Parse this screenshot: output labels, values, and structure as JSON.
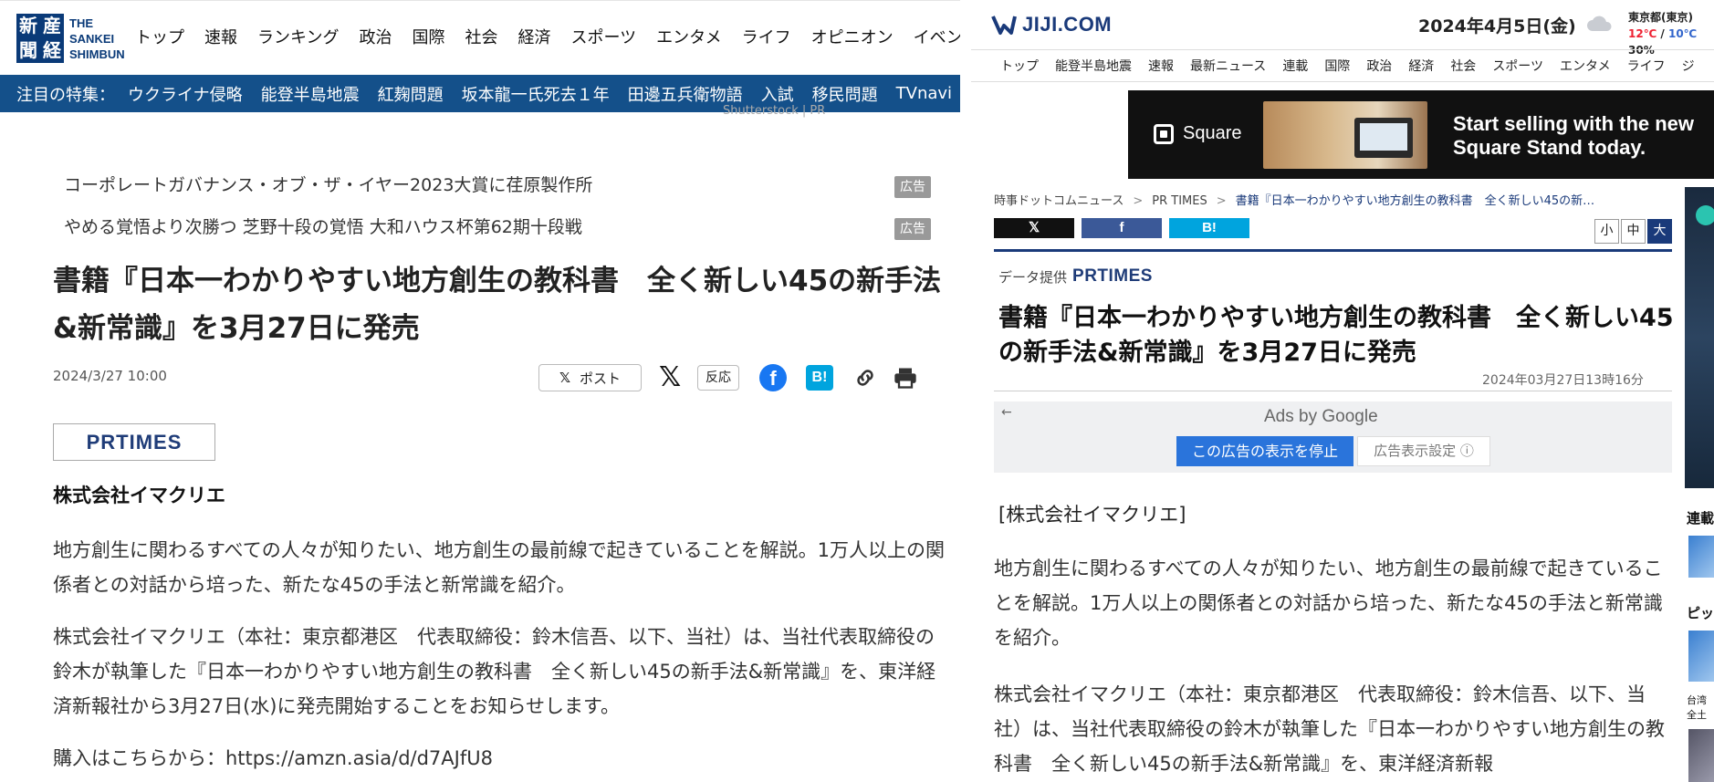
{
  "left": {
    "logo": {
      "kanji": [
        "新",
        "産",
        "聞",
        "経"
      ],
      "text_lines": [
        "THE",
        "SANKEI",
        "SHIMBUN"
      ]
    },
    "nav": [
      "トップ",
      "速報",
      "ランキング",
      "政治",
      "国際",
      "社会",
      "経済",
      "スポーツ",
      "エンタメ",
      "ライフ",
      "オピニオン",
      "イベント"
    ],
    "tokushu": {
      "label": "注目の特集：",
      "items": [
        "ウクライナ侵略",
        "能登半島地震",
        "紅麹問題",
        "坂本龍一氏死去１年",
        "田邊五兵衛物語",
        "入試",
        "移民問題",
        "TVnavi"
      ]
    },
    "credit": "Shutterstock | PR",
    "ads": [
      {
        "text": "コーポレートガバナンス・オブ・ザ・イヤー2023大賞に荏原製作所",
        "badge": "広告"
      },
      {
        "text": "やめる覚悟より次勝つ 芝野十段の覚悟 大和ハウス杯第62期十段戦",
        "badge": "広告"
      }
    ],
    "article": {
      "title": "書籍『日本一わかりやすい地方創生の教科書　全く新しい45の新手法&新常識』を3月27日に発売",
      "date": "2024/3/27 10:00",
      "share": {
        "post_x": "𝕏",
        "post_label": "ポスト",
        "x_icon": "𝕏",
        "hanno": "反応",
        "fb": "f",
        "hatena": "B!"
      },
      "provider_logo": "PRTIMES",
      "company": "株式会社イマクリエ",
      "paragraphs": [
        "地方創生に関わるすべての人々が知りたい、地方創生の最前線で起きていることを解説。1万人以上の関係者との対話から培った、新たな45の手法と新常識を紹介。",
        "株式会社イマクリエ（本社：東京都港区　代表取締役：鈴木信吾、以下、当社）は、当社代表取締役の鈴木が執筆した『日本一わかりやすい地方創生の教科書　全く新しい45の新手法&新常識』を、東洋経済新報社から3月27日(水)に発売開始することをお知らせします。",
        "購入はこちらから：https://amzn.asia/d/d7AJfU8"
      ]
    }
  },
  "right": {
    "logo_text": "JIJI.COM",
    "date": "2024年4月5日(金)",
    "weather": {
      "city": "東京都(東京)",
      "high": "12℃",
      "sep": " / ",
      "low": "10℃",
      "rain": " 30%"
    },
    "nav": [
      "トップ",
      "能登半島地震",
      "速報",
      "最新ニュース",
      "連載",
      "国際",
      "政治",
      "経済",
      "社会",
      "スポーツ",
      "エンタメ",
      "ライフ",
      "ジ"
    ],
    "ad": {
      "brand": "Square",
      "line1": "Start selling with the new",
      "line2": "Square Stand today."
    },
    "breadcrumb": {
      "root": "時事ドットコムニュース",
      "sep": ">",
      "mid": "PR TIMES",
      "current": "書籍『日本一わかりやすい地方創生の教科書　全く新しい45の新…"
    },
    "share": {
      "x": "𝕏",
      "fb": "f",
      "hatena": "B!"
    },
    "font_sizes": [
      "小",
      "中",
      "大"
    ],
    "provider": {
      "label": "データ提供",
      "name": "PRTIMES"
    },
    "title": "書籍『日本一わかりやすい地方創生の教科書　全く新しい45の新手法&新常識』を3月27日に発売",
    "timestamp": "2024年03月27日13時16分",
    "google_ad": {
      "back": "←",
      "title": "Ads by Google",
      "stop": "この広告の表示を停止",
      "settings": "広告表示設定 ⓘ"
    },
    "company": "[株式会社イマクリエ]",
    "paragraphs": [
      "地方創生に関わるすべての人々が知りたい、地方創生の最前線で起きていることを解説。1万人以上の関係者との対話から培った、新たな45の手法と新常識を紹介。",
      "株式会社イマクリエ（本社：東京都港区　代表取締役：鈴木信吾、以下、当社）は、当社代表取締役の鈴木が執筆した『日本一わかりやすい地方創生の教科書　全く新しい45の新手法&新常識』を、東洋経済新報"
    ],
    "side": {
      "label1": "連載",
      "label2": "ピッ",
      "cap1": "台湾",
      "cap2": "全土"
    }
  },
  "colors": {
    "sankei_navy": "#0a3a78",
    "sankei_bar": "#14508a",
    "jiji_navy": "#1a3a7a",
    "x_black": "#111111",
    "fb_blue": "#1877f2",
    "hatena_blue": "#00a4de",
    "google_blue": "#2a74db"
  }
}
